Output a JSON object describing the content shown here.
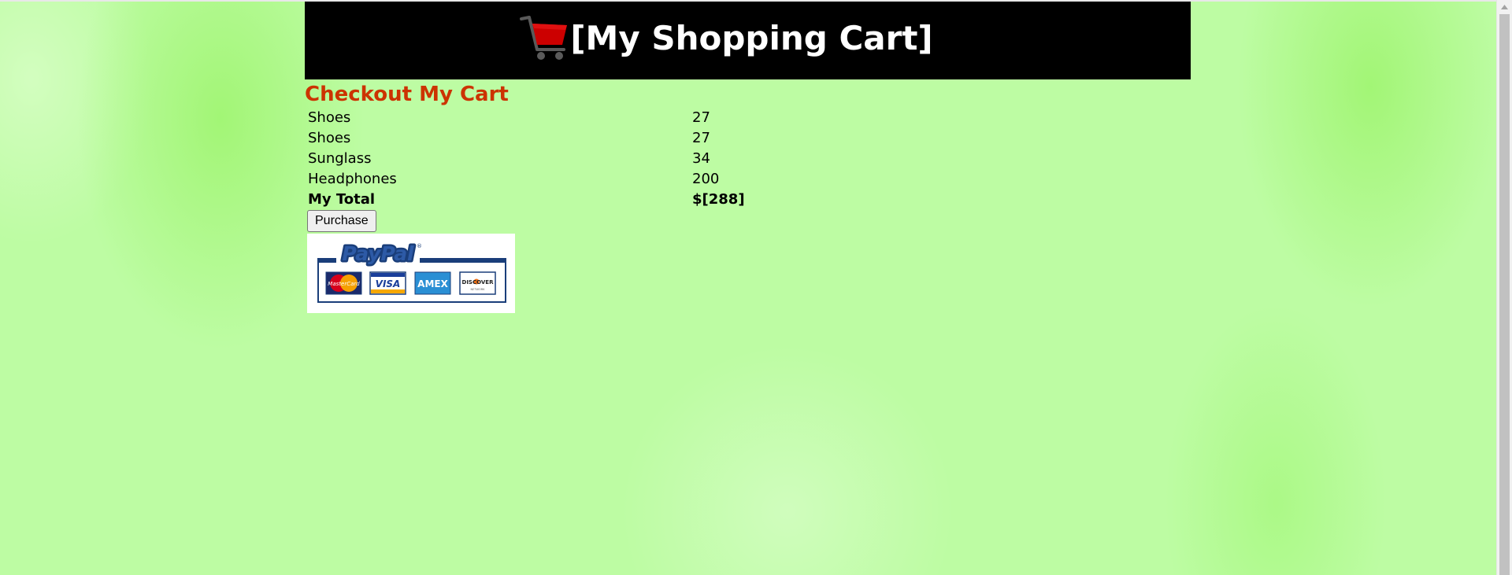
{
  "header": {
    "title": "[My Shopping Cart]",
    "icon": "shopping-cart-icon",
    "cart_colors": {
      "basket": "#cc0000",
      "frame": "#555555"
    }
  },
  "checkout": {
    "heading": "Checkout My Cart",
    "items": [
      {
        "name": "Shoes",
        "price": "27"
      },
      {
        "name": "Shoes",
        "price": "27"
      },
      {
        "name": "Sunglass",
        "price": "34"
      },
      {
        "name": "Headphones",
        "price": "200"
      }
    ],
    "total_label": "My Total",
    "total_value": "$[288]",
    "purchase_label": "Purchase"
  },
  "payment": {
    "brand": "PayPal",
    "cards": [
      "MasterCard",
      "VISA",
      "AMEX",
      "DISCOVER"
    ]
  },
  "colors": {
    "background": "#bdfca3",
    "header_bg": "#000000",
    "heading": "#cc3300",
    "paypal_blue": "#1a3e7a"
  }
}
